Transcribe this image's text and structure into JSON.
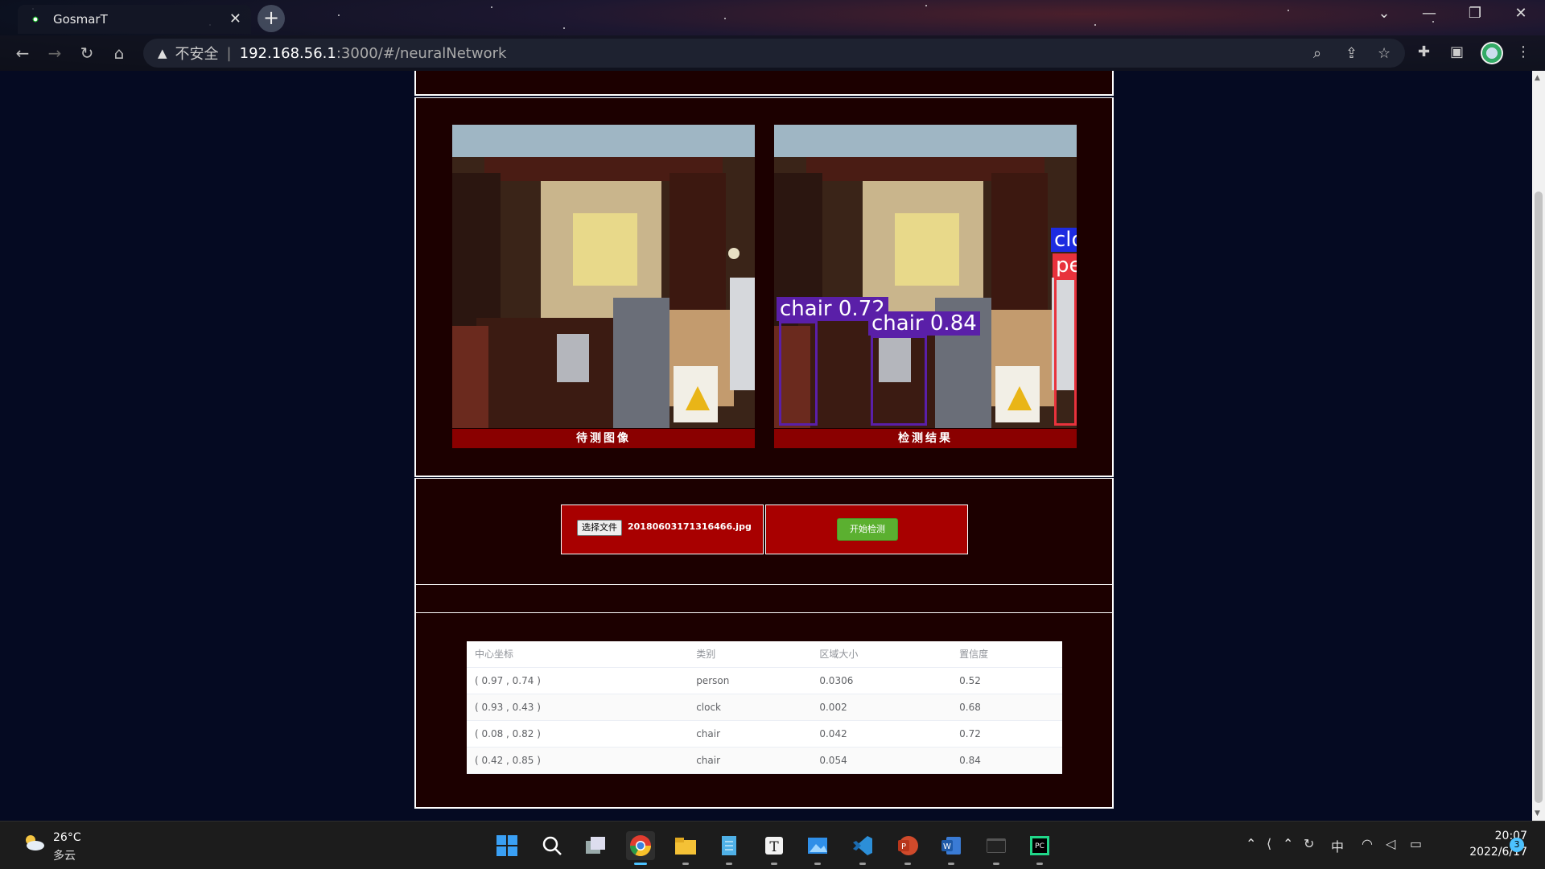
{
  "browser": {
    "tab_title": "GosmarT",
    "tab_close": "✕",
    "new_tab": "+",
    "security_label": "不安全",
    "url_host": "192.168.56.1",
    "url_path": ":3000/#/neuralNetwork",
    "window_controls": [
      "chevron-down-icon",
      "minimize-icon",
      "restore-icon",
      "close-icon"
    ]
  },
  "images": {
    "input_caption": "待测图像",
    "result_caption": "检测结果",
    "detections": [
      {
        "label": "chair 0.72",
        "color": "#5a1fa8"
      },
      {
        "label": "chair 0.84",
        "color": "#5a1fa8"
      },
      {
        "label": "clo",
        "color": "#1d2be0"
      },
      {
        "label": "pe",
        "color": "#e8323c"
      }
    ]
  },
  "upload": {
    "choose_file_label": "选择文件",
    "file_name": "20180603171316466.jpg",
    "start_button_label": "开始检测"
  },
  "results_table": {
    "headers": [
      "中心坐标",
      "类别",
      "区域大小",
      "置信度"
    ],
    "rows": [
      [
        "( 0.97 , 0.74 )",
        "person",
        "0.0306",
        "0.52"
      ],
      [
        "( 0.93 , 0.43 )",
        "clock",
        "0.002",
        "0.68"
      ],
      [
        "( 0.08 , 0.82 )",
        "chair",
        "0.042",
        "0.72"
      ],
      [
        "( 0.42 , 0.85 )",
        "chair",
        "0.054",
        "0.84"
      ]
    ]
  },
  "taskbar": {
    "temperature": "26°C",
    "weather": "多云",
    "ime": "中",
    "time": "20:07",
    "date": "2022/6/17",
    "notifications": "3",
    "apps": [
      "windows-start-icon",
      "search-icon",
      "task-view-icon",
      "chrome-icon",
      "file-explorer-icon",
      "notepad-icon",
      "typora-icon",
      "photos-icon",
      "vscode-icon",
      "powerpoint-icon",
      "word-icon",
      "terminal-icon",
      "pycharm-icon"
    ]
  },
  "colors": {
    "panel_bg": "#1c0000",
    "caption_bg": "#8a0000",
    "upload_bg": "#a80000",
    "start_button": "#5bb030",
    "page_bg": "#050a22"
  }
}
